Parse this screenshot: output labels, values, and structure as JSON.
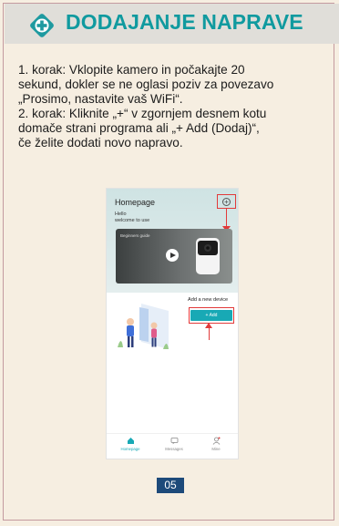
{
  "header": {
    "title": "DODAJANJE NAPRAVE",
    "icon": "plus-badge-icon",
    "title_color": "#109a9f"
  },
  "body_lines": [
    "1. korak: Vklopite kamero in počakajte 20",
    "sekund, dokler se ne oglasi poziv za povezavo",
    "„Prosimo, nastavite vaš WiFi“.",
    "2. korak: Kliknite „+“ v zgornjem desnem kotu",
    "domače strani programa ali „+ Add (Dodaj)“,",
    "če želite dodati novo napravo."
  ],
  "phone": {
    "app_title": "Homepage",
    "greeting_line1": "Hello",
    "greeting_line2": "welcome to use",
    "add_icon": "+",
    "video_label": "Beginners guide",
    "add_device_label": "Add a new device",
    "add_button": "+ Add",
    "accent": "#18a9b5",
    "highlight": "#e23a3a",
    "nav": [
      {
        "label": "Homepage",
        "icon": "home-icon"
      },
      {
        "label": "Messages",
        "icon": "message-icon"
      },
      {
        "label": "Mine",
        "icon": "user-icon"
      }
    ]
  },
  "page_number": "05"
}
